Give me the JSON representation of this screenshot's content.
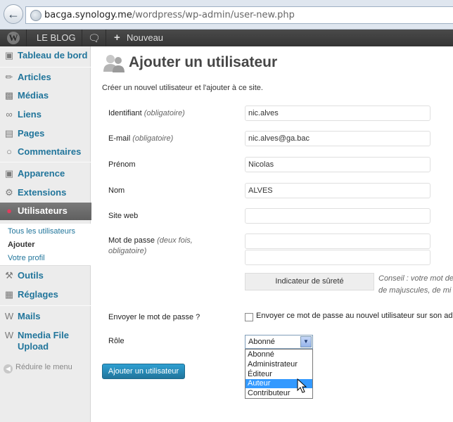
{
  "browser": {
    "url_host": "bacga.synology.me",
    "url_path": "/wordpress/wp-admin/user-new.php"
  },
  "adminbar": {
    "blog_label": "LE BLOG",
    "new_label": "Nouveau"
  },
  "sidebar": {
    "dashboard": "Tableau de bord",
    "articles": "Articles",
    "medias": "Médias",
    "liens": "Liens",
    "pages": "Pages",
    "commentaires": "Commentaires",
    "apparence": "Apparence",
    "extensions": "Extensions",
    "utilisateurs": "Utilisateurs",
    "sub": [
      "Tous les utilisateurs",
      "Ajouter",
      "Votre profil"
    ],
    "outils": "Outils",
    "reglages": "Réglages",
    "mails": "Mails",
    "nmedia_1": "Nmedia File",
    "nmedia_2": "Upload",
    "collapse": "Réduire le menu"
  },
  "main": {
    "title": "Ajouter un utilisateur",
    "description": "Créer un nouvel utilisateur et l'ajouter à ce site.",
    "fields": {
      "identifiant_label": "Identifiant",
      "identifiant_req": "(obligatoire)",
      "identifiant_value": "nic.alves",
      "email_label": "E-mail",
      "email_req": "(obligatoire)",
      "email_value": "nic.alves@ga.bac",
      "prenom_label": "Prénom",
      "prenom_value": "Nicolas",
      "nom_label": "Nom",
      "nom_value": "ALVES",
      "site_label": "Site web",
      "site_value": "",
      "password_label": "Mot de passe",
      "password_req_1": "(deux fois,",
      "password_req_2": "obligatoire)"
    },
    "strength_label": "Indicateur de sûreté",
    "hint_line1": "Conseil : votre mot de",
    "hint_line2": "de majuscules, de mi",
    "send_password_label": "Envoyer le mot de passe ?",
    "send_password_checkbox": "Envoyer ce mot de passe au nouvel utilisateur sur son adre",
    "role_label": "Rôle",
    "role_selected": "Abonné",
    "role_options": [
      "Abonné",
      "Administrateur",
      "Éditeur",
      "Auteur",
      "Contributeur"
    ],
    "role_highlighted": "Auteur",
    "submit_label": "Ajouter un utilisateur"
  },
  "colors": {
    "link": "#21759b",
    "admin_bar": "#464646",
    "highlight": "#3399ff",
    "primary_button": "#21759b"
  }
}
